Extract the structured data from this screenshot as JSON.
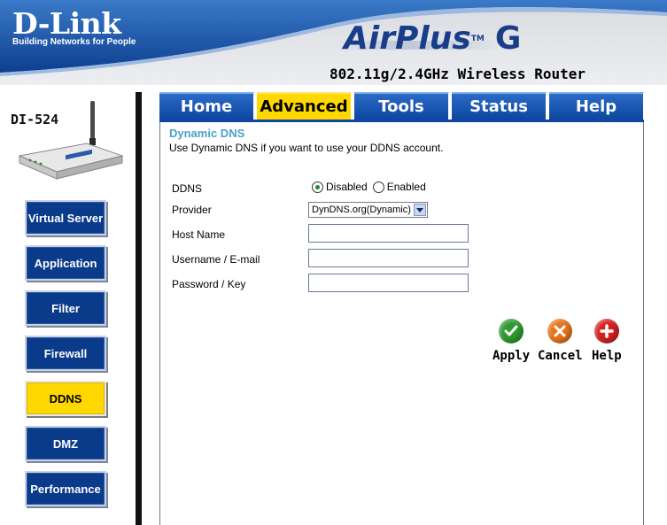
{
  "brand": {
    "logo": "D-Link",
    "tagline": "Building Networks for People",
    "product_air": "Air",
    "product_plus": "Plus",
    "product_g": "G",
    "trademark": "TM",
    "model_title": "802.11g/2.4GHz Wireless Router"
  },
  "device": {
    "label": "DI-524"
  },
  "sidebar": {
    "items": [
      {
        "label": "Virtual Server"
      },
      {
        "label": "Application"
      },
      {
        "label": "Filter"
      },
      {
        "label": "Firewall"
      },
      {
        "label": "DDNS",
        "active": true
      },
      {
        "label": "DMZ"
      },
      {
        "label": "Performance"
      }
    ]
  },
  "tabs": [
    {
      "label": "Home"
    },
    {
      "label": "Advanced",
      "active": true
    },
    {
      "label": "Tools"
    },
    {
      "label": "Status"
    },
    {
      "label": "Help"
    }
  ],
  "content": {
    "title": "Dynamic DNS",
    "description": "Use Dynamic DNS if you want to use your DDNS account.",
    "ddns_label": "DDNS",
    "ddns_options": [
      "Disabled",
      "Enabled"
    ],
    "ddns_selected": "Disabled",
    "provider_label": "Provider",
    "provider_value": "DynDNS.org(Dynamic)",
    "host_label": "Host Name",
    "host_value": "",
    "username_label": "Username / E-mail",
    "username_value": "",
    "password_label": "Password / Key",
    "password_value": ""
  },
  "actions": {
    "apply": "Apply",
    "cancel": "Cancel",
    "help": "Help"
  },
  "colors": {
    "brand_blue": "#0e469f",
    "active_yellow": "#ffd800",
    "title_teal": "#4aa0c8",
    "apply_green": "#2e9a2e",
    "cancel_orange": "#e8731a",
    "help_red": "#d42020"
  }
}
